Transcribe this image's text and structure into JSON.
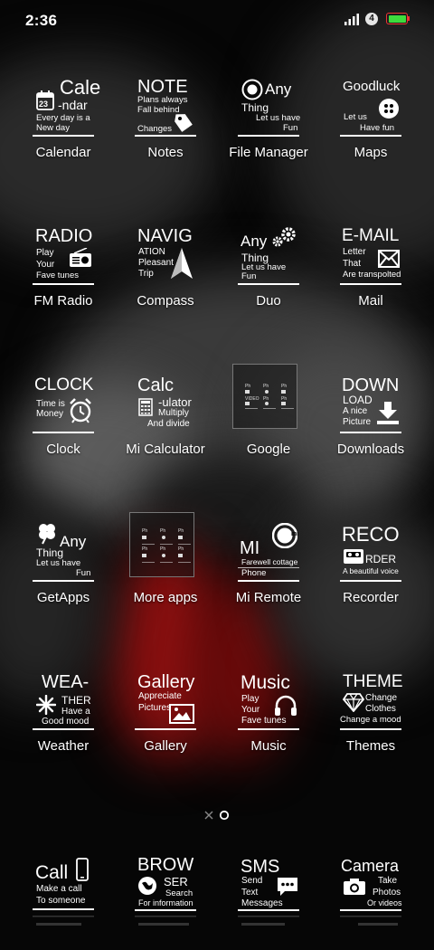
{
  "status": {
    "time": "2:36",
    "notification_count": "4"
  },
  "rows": [
    [
      {
        "label": "Calendar",
        "tile": {
          "big": "Cale",
          "big2": "-ndar",
          "date": "23",
          "line1": "Every day is a",
          "line2": "New day"
        }
      },
      {
        "label": "Notes",
        "tile": {
          "big": "NOTE",
          "line1": "Plans always",
          "line2": "Fall behind",
          "line3": "Changes"
        }
      },
      {
        "label": "File Manager",
        "tile": {
          "big": "Any",
          "line1": "Thing",
          "line2": "Let us have",
          "line3": "Fun"
        }
      },
      {
        "label": "Maps",
        "tile": {
          "big": "Goodluck",
          "line1": "Let us",
          "line2": "Have fun"
        }
      }
    ],
    [
      {
        "label": "FM Radio",
        "tile": {
          "big": "RADIO",
          "line1": "Play",
          "line2": "Your",
          "line3": "Fave tunes"
        }
      },
      {
        "label": "Compass",
        "tile": {
          "big": "NAVIG",
          "line1": "ATION",
          "line2": "Pleasant",
          "line3": "Trip"
        }
      },
      {
        "label": "Duo",
        "tile": {
          "big": "Any",
          "line1": "Thing",
          "line2": "Let us have",
          "line3": "Fun"
        }
      },
      {
        "label": "Mail",
        "tile": {
          "big": "E-MAIL",
          "line1": "Letter",
          "line2": "That",
          "line3": "Are transpolted"
        }
      }
    ],
    [
      {
        "label": "Clock",
        "tile": {
          "big": "CLOCK",
          "line1": "Time is",
          "line2": "Money"
        }
      },
      {
        "label": "Mi Calculator",
        "tile": {
          "big": "Calc",
          "line1": "-ulator",
          "line2": "Multiply",
          "line3": "And divide"
        }
      },
      {
        "label": "Google",
        "tile": {
          "mini": [
            "Ph",
            "Ph",
            "Ph",
            "VIDEO",
            "Ph",
            "Ph"
          ]
        }
      },
      {
        "label": "Downloads",
        "tile": {
          "big": "DOWN",
          "line1": "LOAD",
          "line2": "A nice",
          "line3": "Picture"
        }
      }
    ],
    [
      {
        "label": "GetApps",
        "tile": {
          "big": "Any",
          "line1": "Thing",
          "line2": "Let us have",
          "line3": "Fun"
        }
      },
      {
        "label": "More apps",
        "tile": {
          "mini": [
            "Ph",
            "Ph",
            "Ph",
            "Ph",
            "Ph",
            "Ph"
          ]
        }
      },
      {
        "label": "Mi Remote",
        "tile": {
          "big": "MI",
          "badge": "mi",
          "line1": "Farewell cottage",
          "line2": "Phone"
        }
      },
      {
        "label": "Recorder",
        "tile": {
          "big": "RECO",
          "line1": "RDER",
          "line2": "A beautiful voice"
        }
      }
    ],
    [
      {
        "label": "Weather",
        "tile": {
          "big": "WEA-",
          "line1": "THER",
          "line2": "Have a",
          "line3": "Good mood"
        }
      },
      {
        "label": "Gallery",
        "tile": {
          "big": "Gallery",
          "line1": "Appreciate",
          "line2": "Pictures"
        }
      },
      {
        "label": "Music",
        "tile": {
          "big": "Music",
          "line1": "Play",
          "line2": "Your",
          "line3": "Fave tunes"
        }
      },
      {
        "label": "Themes",
        "tile": {
          "big": "THEME",
          "line1": "Change",
          "line2": "Clothes",
          "line3": "Change a mood"
        }
      }
    ]
  ],
  "dock": [
    {
      "name": "Call",
      "tile": {
        "big": "Call",
        "line1": "Make a call",
        "line2": "To someone"
      }
    },
    {
      "name": "Browser",
      "tile": {
        "big": "BROW",
        "line1": "SER",
        "line2": "Search",
        "line3": "For information"
      }
    },
    {
      "name": "SMS",
      "tile": {
        "big": "SMS",
        "line1": "Send",
        "line2": "Text",
        "line3": "Messages"
      }
    },
    {
      "name": "Camera",
      "tile": {
        "big": "Camera",
        "line1": "Take",
        "line2": "Photos",
        "line3": "Or videos"
      }
    }
  ],
  "page_indicator": {
    "pages": 2,
    "current": 2
  }
}
